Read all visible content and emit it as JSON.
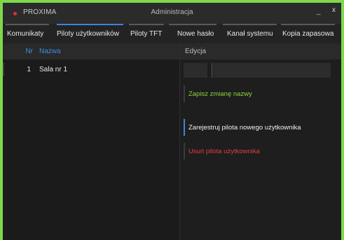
{
  "window": {
    "app_name": "PROXIMA",
    "title": "Administracja",
    "minimize_label": "_",
    "close_label": "x"
  },
  "tabs": [
    {
      "label": "Komunikaty",
      "active": false
    },
    {
      "label": "Piloty użytkowników",
      "active": true
    },
    {
      "label": "Piloty TFT",
      "active": false
    },
    {
      "label": "Nowe hasło",
      "active": false
    },
    {
      "label": "Kanał systemu",
      "active": false
    },
    {
      "label": "Kopia zapasowa",
      "active": false
    }
  ],
  "list": {
    "headers": {
      "nr": "Nr",
      "name": "Nazwa"
    },
    "rows": [
      {
        "nr": "1",
        "name": "Sala nr 1"
      }
    ]
  },
  "edit": {
    "header": "Edycja",
    "name_value": "",
    "save_label": "Zapisz zmianę nazwy",
    "register_label": "Zarejestruj pilota nowego użytkownika",
    "delete_label": "Usuń pilota użytkownika"
  },
  "colors": {
    "frame": "#7dd84a",
    "accent": "#3c86d8",
    "save": "#8fd63a",
    "delete": "#e0403a"
  }
}
